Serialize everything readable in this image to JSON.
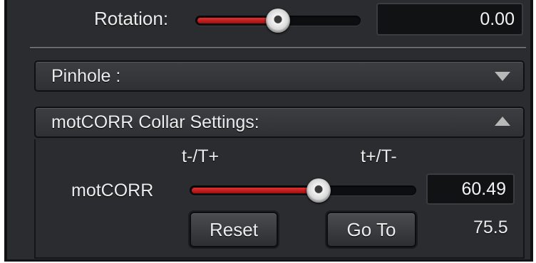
{
  "rotation": {
    "label": "Rotation:",
    "value": "0.00",
    "slider_fraction": 0.5
  },
  "pinhole": {
    "title": "Pinhole :",
    "expanded": false
  },
  "motcorr_section": {
    "title": "motCORR Collar Settings:",
    "expanded": true,
    "left_marker": "t-/T+",
    "right_marker": "t+/T-",
    "control_label": "motCORR",
    "value": "60.49",
    "slider_fraction": 0.57,
    "reset_label": "Reset",
    "goto_label": "Go To",
    "goto_value": "75.5"
  },
  "colors": {
    "panel_bg": "#2a2c2f",
    "slider_fill": "#c42020",
    "text": "#ececec"
  }
}
